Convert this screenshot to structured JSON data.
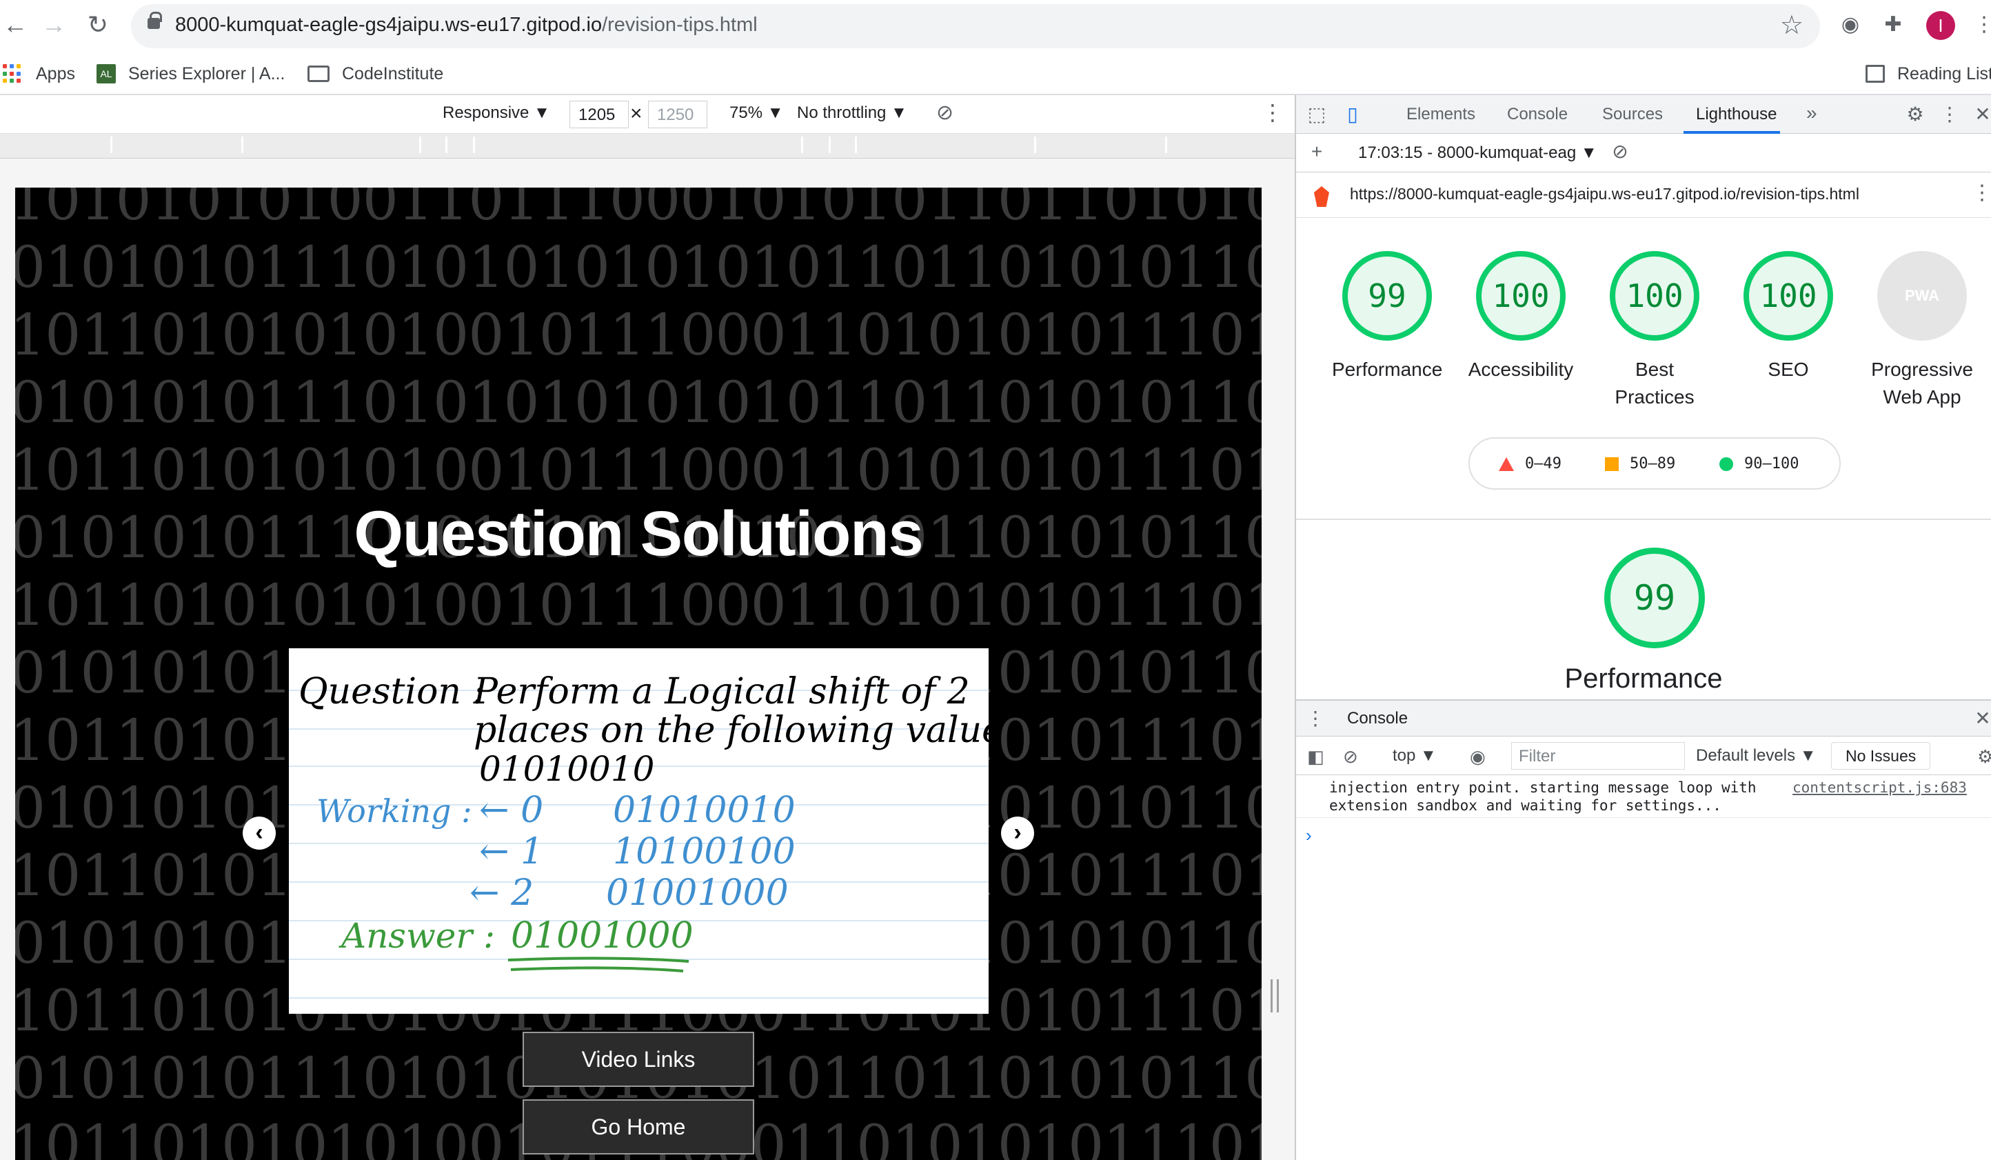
{
  "browser": {
    "url_host": "8000-kumquat-eagle-gs4jaipu.ws-eu17.gitpod.io",
    "url_path": "/revision-tips.html",
    "profile_initial": "I",
    "bookmarks": {
      "apps": "Apps",
      "series_explorer": "Series Explorer | A...",
      "series_explorer_favicon": "AL",
      "code_institute": "CodeInstitute",
      "reading_list": "Reading List"
    }
  },
  "device_toolbar": {
    "mode": "Responsive ▼",
    "width": "1205",
    "times": "×",
    "height": "1250",
    "zoom": "75% ▼",
    "throttling": "No throttling ▼"
  },
  "page": {
    "title": "Question Solutions",
    "binary_lines": [
      "1010101010011011100010101011011010101101010111",
      "0101010111010101010101011011010101101010101",
      "1011010101010010111000110101010111010110",
      "0101010111010101010101011011010101101010101",
      "1011010101010010111000110101010111010110",
      "0101010111010101010101011011010101101010101",
      "1011010101010010111000110101010111010110",
      "0101010111010101010101011011010101101010101",
      "1011010101010010111000110101010111010110",
      "0101010111010101010101011011010101101010101",
      "1011010101010010111000110101010111010110",
      "0101010111010101010101011011010101101010101",
      "1011010101010010111000110101010111010110",
      "0101010111010101010101011011010101101010101",
      "1011010101010010111000110101010111010110"
    ],
    "slide": {
      "question_label": "Question :",
      "question_line1": "Perform a Logical shift of 2",
      "question_line2": "places on the following value :",
      "question_value": "01010010",
      "working_label": "Working :",
      "steps": [
        {
          "shift": "← 0",
          "value": "01010010"
        },
        {
          "shift": "← 1",
          "value": "10100100"
        },
        {
          "shift": "← 2",
          "value": "01001000"
        }
      ],
      "answer_label": "Answer :",
      "answer_value": "01001000"
    },
    "prev_symbol": "‹",
    "next_symbol": "›",
    "buttons": {
      "video_links": "Video Links",
      "go_home": "Go Home"
    }
  },
  "devtools": {
    "tabs": [
      "Elements",
      "Console",
      "Sources",
      "Lighthouse"
    ],
    "more": "»",
    "report_select": "17:03:15 - 8000-kumquat-eag ▼",
    "report_url": "https://8000-kumquat-eagle-gs4jaipu.ws-eu17.gitpod.io/revision-tips.html",
    "scores": [
      {
        "label": "Performance",
        "value": "99"
      },
      {
        "label": "Accessibility",
        "value": "100"
      },
      {
        "label": "Best Practices",
        "value": "100"
      },
      {
        "label": "SEO",
        "value": "100"
      },
      {
        "label": "Progressive Web App",
        "value": "PWA"
      }
    ],
    "legend": {
      "fail": "0–49",
      "average": "50–89",
      "pass": "90–100"
    },
    "colors": {
      "pass": "#0cce6b",
      "average": "#ffa400",
      "fail": "#ff4e42"
    },
    "performance_score": "99",
    "performance_label": "Performance",
    "drawer": {
      "tab": "Console",
      "context": "top ▼",
      "filter_placeholder": "Filter",
      "levels": "Default levels ▼",
      "issues": "No Issues",
      "message_line1": "injection entry point. starting message loop with",
      "message_line2": "extension sandbox and waiting for settings...",
      "message_source": "contentscript.js:683",
      "prompt": "›"
    }
  }
}
